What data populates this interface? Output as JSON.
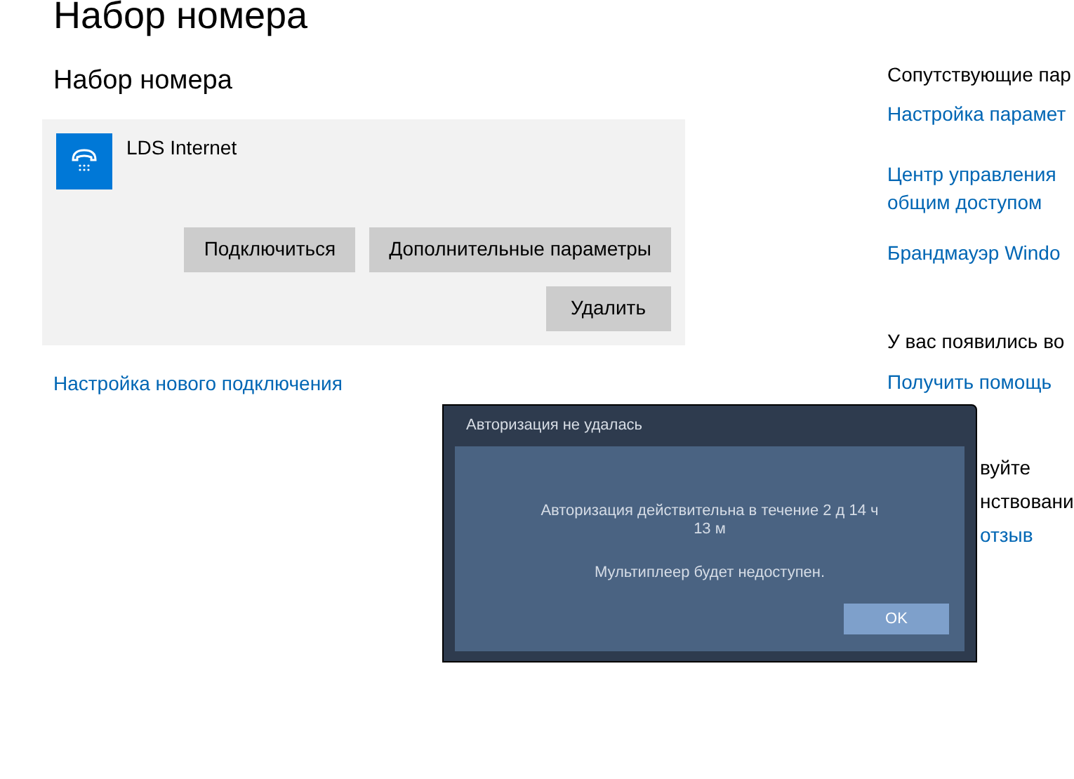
{
  "page_title": "Набор номера",
  "section_title": "Набор номера",
  "connection": {
    "name": "LDS Internet",
    "buttons": [
      "Подключиться",
      "Дополнительные параметры",
      "Удалить"
    ]
  },
  "new_connection_link": "Настройка нового подключения",
  "related": {
    "heading": "Сопутствующие пар",
    "links": [
      "Настройка парамет",
      "Центр управления",
      "общим доступом",
      "Брандмауэр Windo"
    ]
  },
  "help": {
    "heading": "У вас появились во",
    "link": "Получить помощь"
  },
  "feedback": {
    "lines": [
      "вуйте",
      "нствовани"
    ],
    "link": "отзыв"
  },
  "dialog": {
    "title": "Авторизация не удалась",
    "message": "Авторизация действительна в течение 2 д 14 ч 13 м",
    "note": "Мультиплеер будет недоступен.",
    "button": "OK"
  }
}
